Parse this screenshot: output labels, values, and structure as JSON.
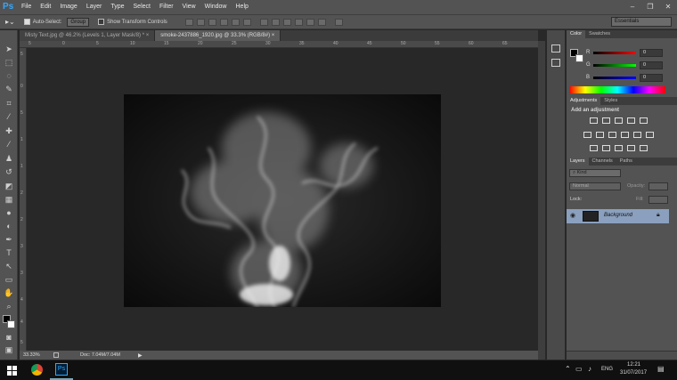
{
  "app": {
    "logo": "Ps"
  },
  "menu": [
    "File",
    "Edit",
    "Image",
    "Layer",
    "Type",
    "Select",
    "Filter",
    "View",
    "Window",
    "Help"
  ],
  "window_controls": {
    "minimize": "–",
    "restore": "❐",
    "close": "✕"
  },
  "options": {
    "auto_select_label": "Auto-Select:",
    "group_value": "Group",
    "transform_label": "Show Transform Controls",
    "workspace": "Essentials"
  },
  "tabs": [
    {
      "label": "Misty Text.jpg @ 46.2% (Levels 1, Layer Mask/8) *",
      "close": "×"
    },
    {
      "label": "smoke-2437886_1920.jpg @ 33.3% (RGB/8#)",
      "close": "×"
    }
  ],
  "ruler": {
    "top": [
      "5",
      "0",
      "5",
      "10",
      "15",
      "20",
      "25",
      "30",
      "35",
      "40",
      "45",
      "50",
      "55",
      "60",
      "65"
    ],
    "left": [
      "5",
      "0",
      "5",
      "1",
      "1",
      "2",
      "2",
      "3",
      "3",
      "4",
      "4",
      "5"
    ]
  },
  "status": {
    "zoom": "33.33%",
    "doc": "Doc: 7.04M/7.04M"
  },
  "color_panel": {
    "tabs": [
      "Color",
      "Swatches"
    ],
    "channels": [
      {
        "label": "R",
        "value": "0"
      },
      {
        "label": "G",
        "value": "0"
      },
      {
        "label": "B",
        "value": "0"
      }
    ],
    "foreground": "#000000",
    "background": "#ffffff"
  },
  "adjustments_panel": {
    "tabs": [
      "Adjustments",
      "Styles"
    ],
    "heading": "Add an adjustment"
  },
  "layers_panel": {
    "tabs": [
      "Layers",
      "Channels",
      "Paths"
    ],
    "kind": "Kind",
    "blend": "Normal",
    "opacity_label": "Opacity:",
    "lock_label": "Lock:",
    "fill_label": "Fill:",
    "layer_name": "Background"
  },
  "taskbar": {
    "language": "ENG",
    "time": "12:21",
    "date": "31/07/2017"
  },
  "icons": [
    "move-tool-icon",
    "marquee-icon",
    "lasso-icon",
    "quick-select-icon",
    "crop-icon",
    "eyedropper-icon",
    "heal-icon",
    "brush-icon",
    "stamp-icon",
    "history-brush-icon",
    "eraser-icon",
    "gradient-icon",
    "blur-icon",
    "dodge-icon",
    "pen-icon",
    "type-icon",
    "path-select-icon",
    "shape-icon",
    "hand-icon",
    "zoom-icon"
  ]
}
